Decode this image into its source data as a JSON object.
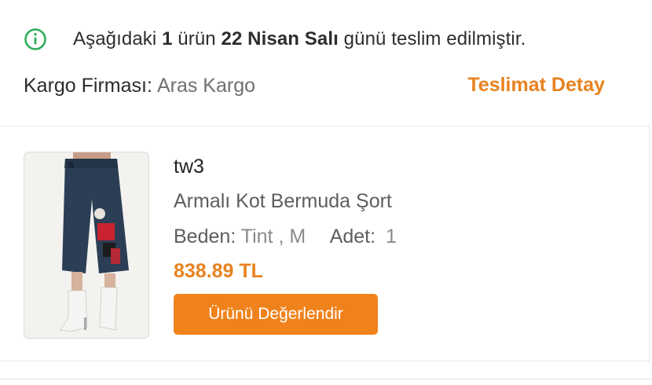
{
  "status": {
    "icon": "info-circle-icon",
    "icon_color": "#2fae5b",
    "prefix": "Aşağıdaki ",
    "count": "1",
    "middle": " ürün ",
    "date": "22 Nisan Salı",
    "suffix": " günü teslim edilmiştir."
  },
  "shipping": {
    "label": "Kargo Firması:",
    "carrier": "Aras Kargo",
    "detail_link": "Teslimat Detay"
  },
  "item": {
    "seller": "tw3",
    "name": "Armalı Kot Bermuda Şort",
    "size_label": "Beden:",
    "size_value": "Tint , M",
    "qty_label": "Adet:",
    "qty_value": "1",
    "price": "838.89 TL",
    "rate_button": "Ürünü Değerlendir",
    "image_alt": "product-photo"
  },
  "colors": {
    "accent": "#f0821b",
    "price": "#e8821f",
    "success": "#2fae5b"
  }
}
